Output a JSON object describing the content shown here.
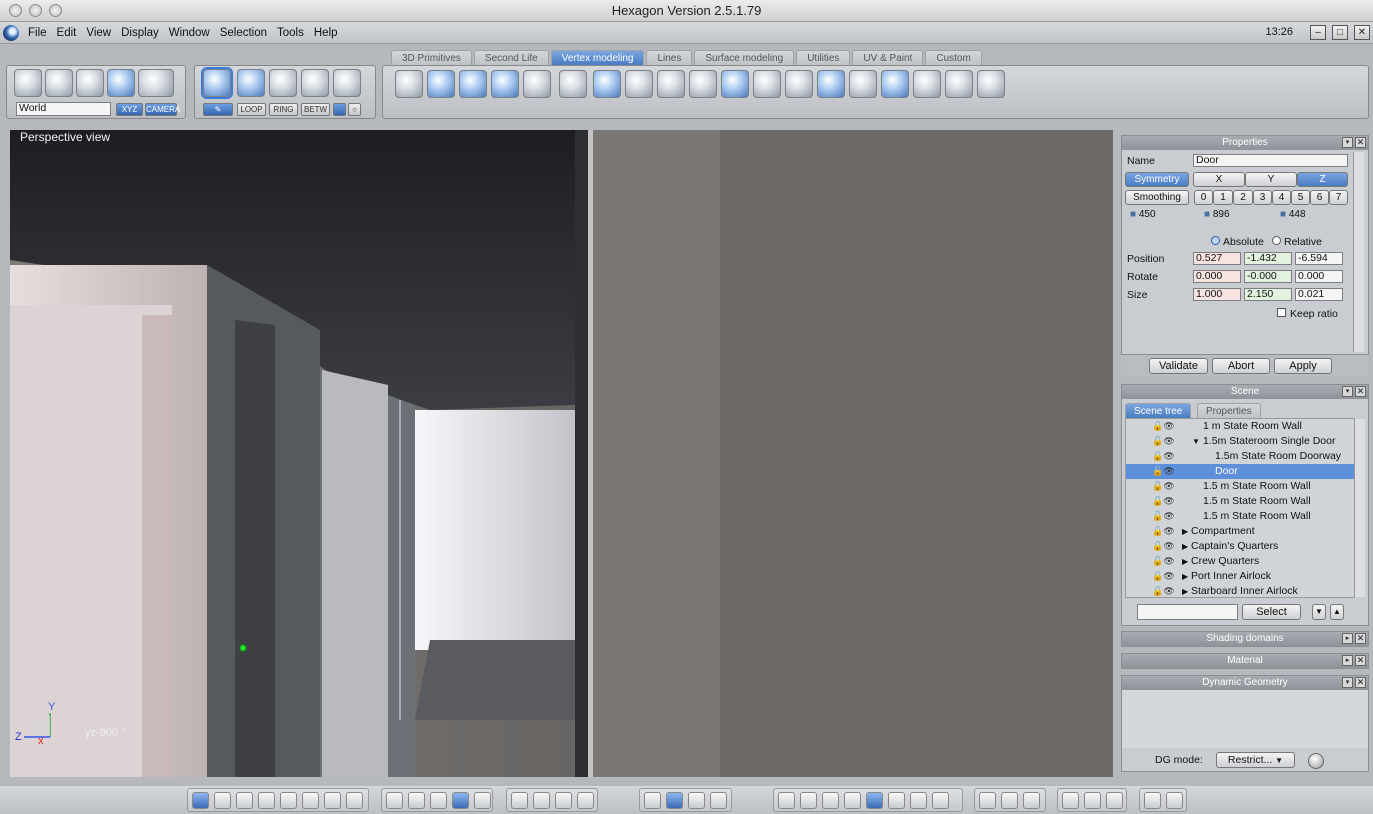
{
  "window": {
    "title": "Hexagon Version 2.5.1.79",
    "clock": "13:26"
  },
  "menu": [
    "File",
    "Edit",
    "View",
    "Display",
    "Window",
    "Selection",
    "Tools",
    "Help"
  ],
  "tabs": [
    {
      "label": "3D Primitives"
    },
    {
      "label": "Second Life"
    },
    {
      "label": "Vertex modeling",
      "active": true
    },
    {
      "label": "Lines"
    },
    {
      "label": "Surface modeling"
    },
    {
      "label": "Utilities"
    },
    {
      "label": "UV & Paint"
    },
    {
      "label": "Custom"
    }
  ],
  "left_toolbar": {
    "coord_select": "World",
    "xyz": "XYZ",
    "camera": "CAMERA",
    "loop": "LOOP",
    "ring": "RING",
    "betw": "BETW"
  },
  "viewport": {
    "label": "Perspective view",
    "axis_label": "yz-900 °",
    "axis_y": "Y",
    "axis_z": "Z"
  },
  "properties": {
    "title": "Properties",
    "name_label": "Name",
    "name_value": "Door",
    "symmetry_label": "Symmetry",
    "sym_axes": [
      "X",
      "Y",
      "Z"
    ],
    "smoothing_label": "Smoothing",
    "smoothing_levels": [
      "0",
      "1",
      "2",
      "3",
      "4",
      "5",
      "6",
      "7"
    ],
    "counts": [
      "450",
      "896",
      "448"
    ],
    "absolute_label": "Absolute",
    "relative_label": "Relative",
    "position_label": "Position",
    "position": [
      "0.527",
      "-1.432",
      "-6.594"
    ],
    "rotate_label": "Rotate",
    "rotate": [
      "0.000",
      "-0.000",
      "0.000"
    ],
    "size_label": "Size",
    "size": [
      "1.000",
      "2.150",
      "0.021"
    ],
    "keep_ratio": "Keep ratio",
    "validate": "Validate",
    "abort": "Abort",
    "apply": "Apply"
  },
  "scene": {
    "title": "Scene",
    "tab_tree": "Scene tree",
    "tab_props": "Properties",
    "items": [
      {
        "label": "1 m State Room Wall"
      },
      {
        "label": "1.5m Stateroom Single Door"
      },
      {
        "label": "1.5m State Room Doorway"
      },
      {
        "label": "Door",
        "selected": true
      },
      {
        "label": "1.5 m State Room Wall"
      },
      {
        "label": "1.5 m State Room Wall"
      },
      {
        "label": "1.5 m State Room Wall"
      },
      {
        "label": "Compartment"
      },
      {
        "label": "Captain's Quarters"
      },
      {
        "label": "Crew Quarters"
      },
      {
        "label": "Port Inner Airlock"
      },
      {
        "label": "Starboard Inner Airlock"
      }
    ],
    "select_button": "Select"
  },
  "collapsed_panels": {
    "shading": "Shading domains",
    "material": "Material"
  },
  "dynamic_geometry": {
    "title": "Dynamic Geometry",
    "dg_mode_label": "DG mode:",
    "dg_mode_value": "Restrict..."
  }
}
